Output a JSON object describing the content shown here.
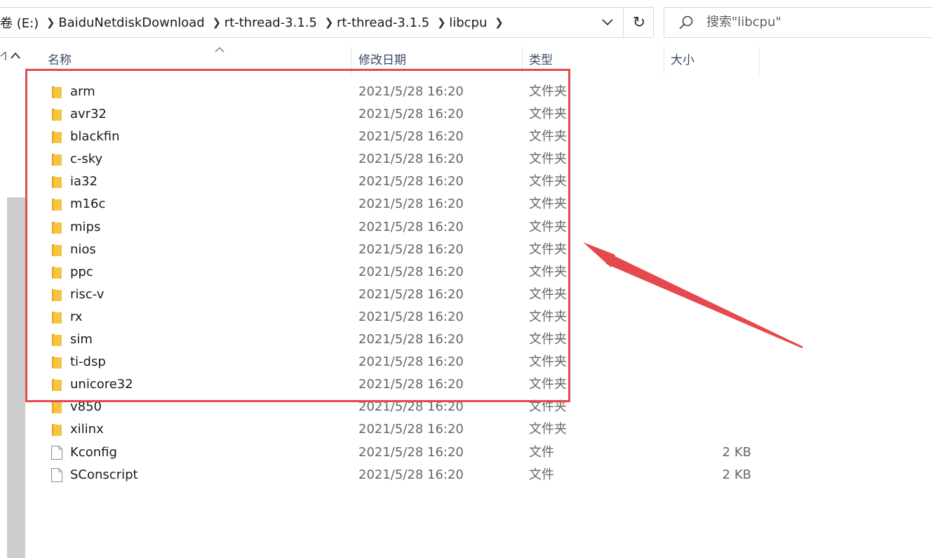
{
  "address": {
    "crumbs": [
      "卷 (E:)",
      "BaiduNetdiskDownload",
      "rt-thread-3.1.5",
      "rt-thread-3.1.5",
      "libcpu"
    ]
  },
  "search": {
    "placeholder": "搜索\"libcpu\""
  },
  "columns": {
    "name": "名称",
    "date": "修改日期",
    "type": "类型",
    "size": "大小"
  },
  "files": [
    {
      "name": "arm",
      "date": "2021/5/28 16:20",
      "type": "文件夹",
      "size": "",
      "icon": "folder-icon"
    },
    {
      "name": "avr32",
      "date": "2021/5/28 16:20",
      "type": "文件夹",
      "size": "",
      "icon": "folder-icon"
    },
    {
      "name": "blackfin",
      "date": "2021/5/28 16:20",
      "type": "文件夹",
      "size": "",
      "icon": "folder-icon"
    },
    {
      "name": "c-sky",
      "date": "2021/5/28 16:20",
      "type": "文件夹",
      "size": "",
      "icon": "folder-icon"
    },
    {
      "name": "ia32",
      "date": "2021/5/28 16:20",
      "type": "文件夹",
      "size": "",
      "icon": "folder-icon"
    },
    {
      "name": "m16c",
      "date": "2021/5/28 16:20",
      "type": "文件夹",
      "size": "",
      "icon": "folder-icon"
    },
    {
      "name": "mips",
      "date": "2021/5/28 16:20",
      "type": "文件夹",
      "size": "",
      "icon": "folder-icon"
    },
    {
      "name": "nios",
      "date": "2021/5/28 16:20",
      "type": "文件夹",
      "size": "",
      "icon": "folder-icon"
    },
    {
      "name": "ppc",
      "date": "2021/5/28 16:20",
      "type": "文件夹",
      "size": "",
      "icon": "folder-icon"
    },
    {
      "name": "risc-v",
      "date": "2021/5/28 16:20",
      "type": "文件夹",
      "size": "",
      "icon": "folder-icon"
    },
    {
      "name": "rx",
      "date": "2021/5/28 16:20",
      "type": "文件夹",
      "size": "",
      "icon": "folder-icon"
    },
    {
      "name": "sim",
      "date": "2021/5/28 16:20",
      "type": "文件夹",
      "size": "",
      "icon": "folder-icon"
    },
    {
      "name": "ti-dsp",
      "date": "2021/5/28 16:20",
      "type": "文件夹",
      "size": "",
      "icon": "folder-icon"
    },
    {
      "name": "unicore32",
      "date": "2021/5/28 16:20",
      "type": "文件夹",
      "size": "",
      "icon": "folder-icon"
    },
    {
      "name": "v850",
      "date": "2021/5/28 16:20",
      "type": "文件夹",
      "size": "",
      "icon": "folder-icon"
    },
    {
      "name": "xilinx",
      "date": "2021/5/28 16:20",
      "type": "文件夹",
      "size": "",
      "icon": "folder-icon"
    },
    {
      "name": "Kconfig",
      "date": "2021/5/28 16:20",
      "type": "文件",
      "size": "2 KB",
      "icon": "file-icon"
    },
    {
      "name": "SConscript",
      "date": "2021/5/28 16:20",
      "type": "文件",
      "size": "2 KB",
      "icon": "file-icon"
    }
  ],
  "colors": {
    "highlight": "#e5484d",
    "folder": "#f5c542",
    "header_text": "#3a4a66"
  },
  "annotation": {
    "highlighted_rows": 14
  }
}
